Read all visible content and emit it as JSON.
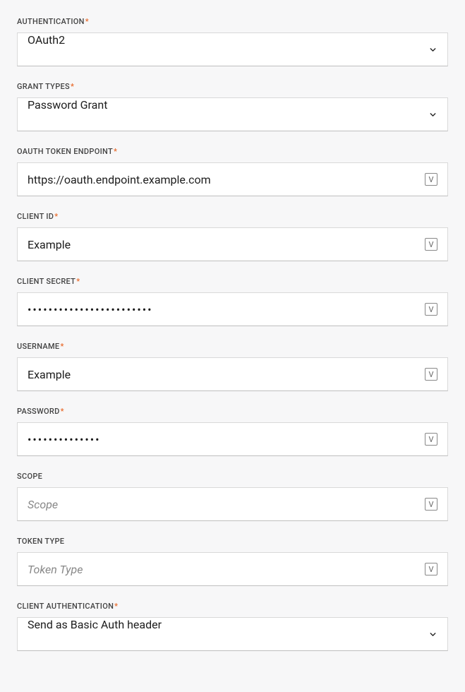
{
  "fields": {
    "authentication": {
      "label": "AUTHENTICATION",
      "required": true,
      "value": "OAuth2"
    },
    "grant_types": {
      "label": "GRANT TYPES",
      "required": true,
      "value": "Password Grant"
    },
    "oauth_token_endpoint": {
      "label": "OAUTH TOKEN ENDPOINT",
      "required": true,
      "value": "https://oauth.endpoint.example.com"
    },
    "client_id": {
      "label": "CLIENT ID",
      "required": true,
      "value": "Example"
    },
    "client_secret": {
      "label": "CLIENT SECRET",
      "required": true,
      "mask": "••••••••••••••••••••••••"
    },
    "username": {
      "label": "USERNAME",
      "required": true,
      "value": "Example"
    },
    "password": {
      "label": "PASSWORD",
      "required": true,
      "mask": "••••••••••••••"
    },
    "scope": {
      "label": "SCOPE",
      "required": false,
      "placeholder": "Scope"
    },
    "token_type": {
      "label": "TOKEN TYPE",
      "required": false,
      "placeholder": "Token Type"
    },
    "client_authentication": {
      "label": "CLIENT AUTHENTICATION",
      "required": true,
      "value": "Send as Basic Auth header"
    }
  },
  "glyphs": {
    "required": "*",
    "var_badge": "V"
  }
}
